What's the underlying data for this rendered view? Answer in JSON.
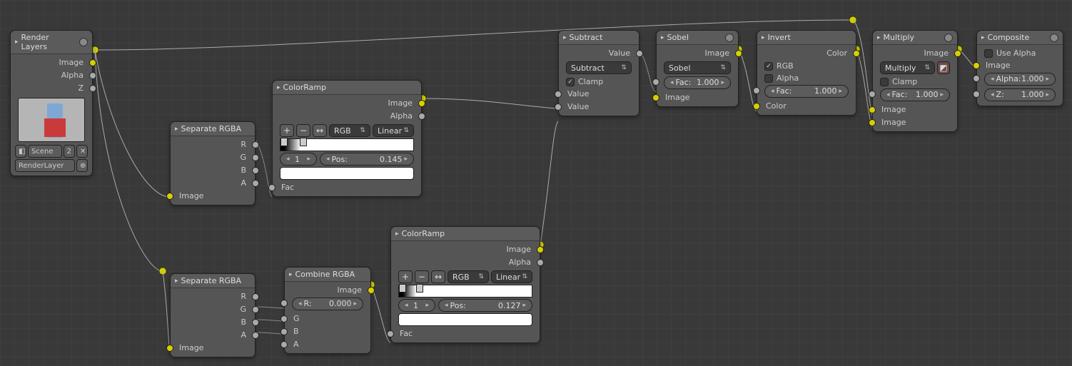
{
  "nodes": {
    "renderLayers": {
      "title": "Render Layers",
      "outputs": [
        "Image",
        "Alpha",
        "Z"
      ],
      "scene": "Scene",
      "sceneUser": "2",
      "layer": "RenderLayer"
    },
    "separate1": {
      "title": "Separate RGBA",
      "outputs": [
        "R",
        "G",
        "B",
        "A"
      ],
      "inputs": [
        "Image"
      ]
    },
    "separate2": {
      "title": "Separate RGBA",
      "outputs": [
        "R",
        "G",
        "B",
        "A"
      ],
      "inputs": [
        "Image"
      ]
    },
    "combine": {
      "title": "Combine RGBA",
      "outputs": [
        "Image"
      ],
      "R": {
        "label": "R:",
        "value": "0.000"
      },
      "inputs": [
        "G",
        "B",
        "A"
      ]
    },
    "ramp1": {
      "title": "ColorRamp",
      "outputs": [
        "Image",
        "Alpha"
      ],
      "input": "Fac",
      "mode": "RGB",
      "interp": "Linear",
      "index": "1",
      "posLabel": "Pos:",
      "posValue": "0.145"
    },
    "ramp2": {
      "title": "ColorRamp",
      "outputs": [
        "Image",
        "Alpha"
      ],
      "input": "Fac",
      "mode": "RGB",
      "interp": "Linear",
      "index": "1",
      "posLabel": "Pos:",
      "posValue": "0.127"
    },
    "subtract": {
      "title": "Subtract",
      "outputs": [
        "Value"
      ],
      "op": "Subtract",
      "clamp": "Clamp",
      "inputs": [
        "Value",
        "Value"
      ]
    },
    "sobel": {
      "title": "Sobel",
      "outputs": [
        "Image"
      ],
      "filter": "Sobel",
      "fac": {
        "label": "Fac:",
        "value": "1.000"
      },
      "input": "Image"
    },
    "invert": {
      "title": "Invert",
      "outputs": [
        "Color"
      ],
      "rgb": "RGB",
      "alpha": "Alpha",
      "fac": {
        "label": "Fac:",
        "value": "1.000"
      },
      "input": "Color"
    },
    "multiply": {
      "title": "Multiply",
      "outputs": [
        "Image"
      ],
      "op": "Multiply",
      "clamp": "Clamp",
      "inputs": [
        "Image",
        "Image"
      ]
    },
    "composite": {
      "title": "Composite",
      "useAlpha": "Use Alpha",
      "input": "Image",
      "alpha": {
        "label": "Alpha:",
        "value": "1.000"
      },
      "z": {
        "label": "Z:",
        "value": "1.000"
      }
    }
  },
  "icons": {
    "plus": "+",
    "minus": "−",
    "swap": "↔",
    "tri": "▸",
    "updown": "⇅",
    "x": "✕",
    "pin": "⊕"
  }
}
